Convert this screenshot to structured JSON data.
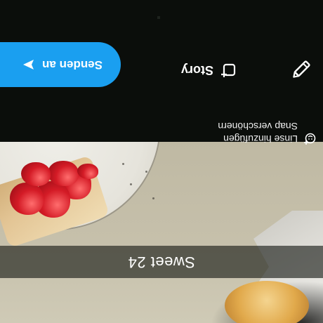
{
  "caption": {
    "text": "Sweet 24"
  },
  "tools": {
    "lens_label": "Linse hinzufügen",
    "edit_label": "Snap verschönern"
  },
  "actions": {
    "story_label": "Story",
    "send_label": "Senden an"
  },
  "colors": {
    "accent": "#1a9ff0",
    "panel": "#0b0e0b",
    "caption_bar": "#141612"
  },
  "icons": {
    "lens": "smiley-plus-icon",
    "pencil": "pencil-icon",
    "story": "story-plus-icon",
    "send": "send-arrow-icon"
  }
}
